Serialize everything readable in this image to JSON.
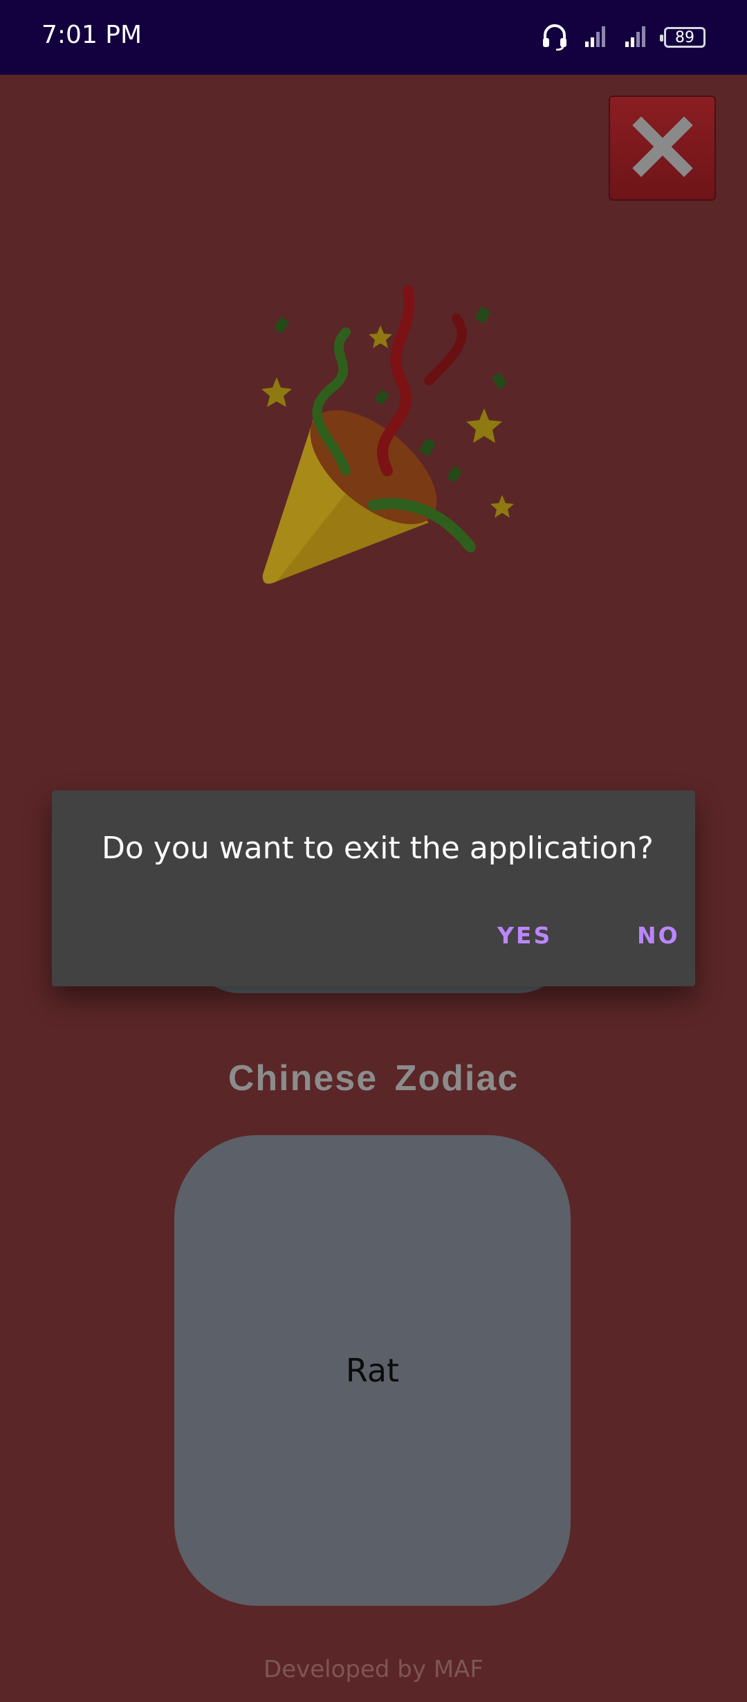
{
  "status_bar": {
    "time": "7:01 PM",
    "battery_level": "89",
    "icons": [
      "headset-icon",
      "signal-icon",
      "signal-icon",
      "battery-icon"
    ]
  },
  "close_button": {
    "icon": "close-icon"
  },
  "illustration": {
    "icon": "party-popper-icon"
  },
  "app_title": "Chinese  Zodiac",
  "zodiac_card": {
    "label": "Rat"
  },
  "footer": "Developed by MAF",
  "dialog": {
    "message": "Do you want to exit the application?",
    "yes_label": "YES",
    "no_label": "NO"
  },
  "colors": {
    "background": "#5b2627",
    "status_bar": "#13003f",
    "dialog": "#424242",
    "accent": "#bb86fc",
    "card": "#5c6068"
  }
}
